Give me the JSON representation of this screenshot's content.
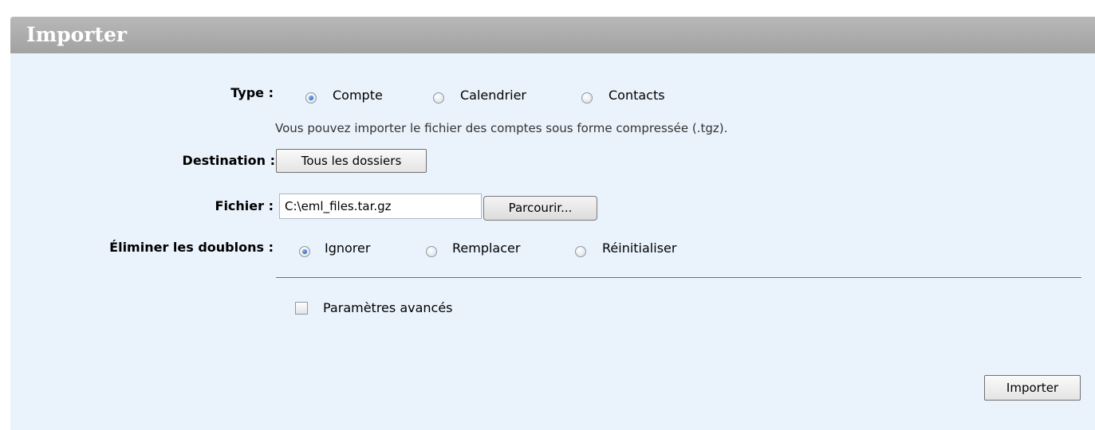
{
  "panel": {
    "title": "Importer"
  },
  "form": {
    "type": {
      "label": "Type :",
      "options": [
        {
          "label": "Compte",
          "checked": true
        },
        {
          "label": "Calendrier",
          "checked": false
        },
        {
          "label": "Contacts",
          "checked": false
        }
      ],
      "hint": "Vous pouvez importer le fichier des comptes sous forme compressée (.tgz)."
    },
    "destination": {
      "label": "Destination :",
      "button": "Tous les dossiers"
    },
    "file": {
      "label": "Fichier :",
      "value": "C:\\eml_files.tar.gz",
      "browse": "Parcourir..."
    },
    "duplicates": {
      "label": "Éliminer les doublons :",
      "options": [
        {
          "label": "Ignorer",
          "checked": true
        },
        {
          "label": "Remplacer",
          "checked": false
        },
        {
          "label": "Réinitialiser",
          "checked": false
        }
      ]
    },
    "advanced": {
      "label": "Paramètres avancés",
      "checked": false
    },
    "submit": "Importer"
  }
}
